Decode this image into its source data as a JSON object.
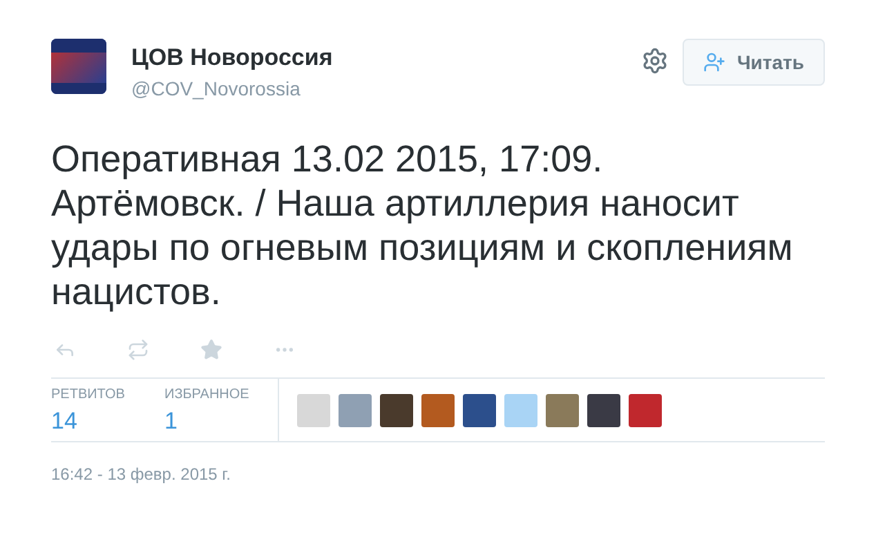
{
  "author": {
    "name": "ЦОВ Новороссия",
    "handle": "@COV_Novorossia"
  },
  "follow_button": {
    "label": "Читать"
  },
  "tweet": {
    "text": "Оперативная 13.02 2015, 17:09. Артёмовск. / Наша артиллерия наносит удары по огневым позициям и скоплениям нацистов."
  },
  "stats": [
    {
      "label": "РЕТВИТОВ",
      "value": "14"
    },
    {
      "label": "ИЗБРАННОЕ",
      "value": "1"
    }
  ],
  "timestamp": "16:42 - 13 февр. 2015 г."
}
